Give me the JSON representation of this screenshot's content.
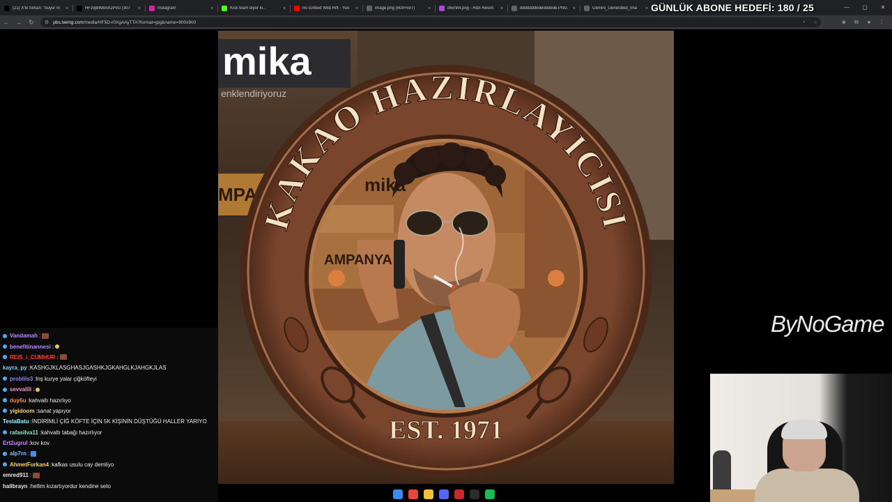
{
  "browser": {
    "tabs": [
      {
        "label": "(21) X'te furkan: \"buyur m",
        "icon": "x-icon",
        "color": "#000000"
      },
      {
        "label": "HFzvjBW8AA2PvG (307",
        "icon": "x-icon",
        "color": "#000000"
      },
      {
        "label": "Instagram",
        "icon": "instagram-icon",
        "color": "#d6249f"
      },
      {
        "label": "Kick team diyor ki...",
        "icon": "kick-icon",
        "color": "#53fc18"
      },
      {
        "label": "no context Wild Rift - You",
        "icon": "youtube-icon",
        "color": "#ff0000"
      },
      {
        "label": "image.png (609×597)",
        "icon": "globe-icon",
        "color": "#5f6368"
      },
      {
        "label": "i85mit4.png - Hizli Resim",
        "icon": "image-host-icon",
        "color": "#a64dd6"
      },
      {
        "label": "dddddddedededede.PNG",
        "icon": "globe-icon",
        "color": "#5f6368"
      },
      {
        "label": "Gemini_Generated_Ima",
        "icon": "globe-icon",
        "color": "#5f6368"
      }
    ],
    "new_tab_label": "+",
    "url_host": "pbs.twimg.com",
    "url_path": "/media/HF5D-r0XgAAyTTA?format=jpg&name=900x900"
  },
  "overlay": {
    "goal_text": "GÜNLÜK ABONE HEDEFİ: 180 / 25",
    "brand": "ByNoGame"
  },
  "image": {
    "arc_text": "KAKAO HAZIRLAYICISI",
    "est_text": "EST. 1971",
    "bg_sign": "mika",
    "bg_sub": "enklendiriyoruz",
    "bg_ampa": "MPA",
    "inner_sign": "mika",
    "inner_ampanya": "AMPANYA",
    "colors": {
      "ring": "#6b3a26",
      "ring_light": "#8c5a3c",
      "text": "#f4e2c4",
      "skin": "#c58a62",
      "shirt": "#7d9aa0"
    }
  },
  "chat": {
    "messages": [
      {
        "user": "Vandamah",
        "user_color": "#b98cff",
        "text": "",
        "emote": "emote",
        "badge": true
      },
      {
        "user": "benefitinannesi",
        "user_color": "#b98cff",
        "text": "",
        "emote": "small",
        "badge": true
      },
      {
        "user": "REIS_i_CUMHUR",
        "user_color": "#ff3b3b",
        "text": "",
        "emote": "emote",
        "badge": true
      },
      {
        "user": "kayra_py",
        "user_color": "#7fd3ff",
        "text": "KASHGJKLASGHASJGASHKJGKAHGLKJAHGKJLAS",
        "emote": "",
        "badge": false
      },
      {
        "user": "probliis3",
        "user_color": "#9e7bff",
        "text": "lnş kurye yalar çiğköfteyi",
        "emote": "",
        "badge": true
      },
      {
        "user": "sevvalili",
        "user_color": "#ff8ad8",
        "text": "",
        "emote": "small",
        "badge": true
      },
      {
        "user": "duy6u",
        "user_color": "#ff8a3d",
        "text": "kahvaltı hazırlıyo",
        "emote": "",
        "badge": true
      },
      {
        "user": "yigidoom",
        "user_color": "#ffd86b",
        "text": "sanat yapıyor",
        "emote": "",
        "badge": true
      },
      {
        "user": "TeslaBatu",
        "user_color": "#9ef0ff",
        "text": "İNDİRİMLİ ÇİĞ KÖFTE İÇİN 5K KİŞİNİN DÜŞTÜĞÜ HALLER YARIYO",
        "emote": "",
        "badge": false
      },
      {
        "user": "rafasilva11",
        "user_color": "#8ae8c5",
        "text": "kahvaltı tabağı hazırlıyor",
        "emote": "",
        "badge": true
      },
      {
        "user": "Ert2ugrul",
        "user_color": "#c78bff",
        "text": "kov kov",
        "emote": "",
        "badge": false
      },
      {
        "user": "alp7rn",
        "user_color": "#7dc8ff",
        "text": "",
        "emote": "blue",
        "badge": true
      },
      {
        "user": "AhmetFurkan4",
        "user_color": "#ffd65c",
        "text": "kafkas usulu cay demliyo",
        "emote": "",
        "badge": true
      },
      {
        "user": "emred911",
        "user_color": "#e8e8e8",
        "text": "",
        "emote": "emote",
        "badge": false
      },
      {
        "user": "hallbrayn",
        "user_color": "#e8e8e8",
        "text": "hellim kızartıyordur kendine seto",
        "emote": "",
        "badge": false
      }
    ]
  },
  "taskbar": {
    "icons": [
      {
        "name": "windows-start-icon",
        "color": "#3b8bea"
      },
      {
        "name": "chrome-icon",
        "color": "#e8453c"
      },
      {
        "name": "file-explorer-icon",
        "color": "#f3c03a"
      },
      {
        "name": "discord-icon",
        "color": "#5865f2"
      },
      {
        "name": "x-app-icon",
        "color": "#c42b2b"
      },
      {
        "name": "obs-icon",
        "color": "#2b2b2b"
      },
      {
        "name": "spotify-icon",
        "color": "#1db954"
      }
    ]
  }
}
